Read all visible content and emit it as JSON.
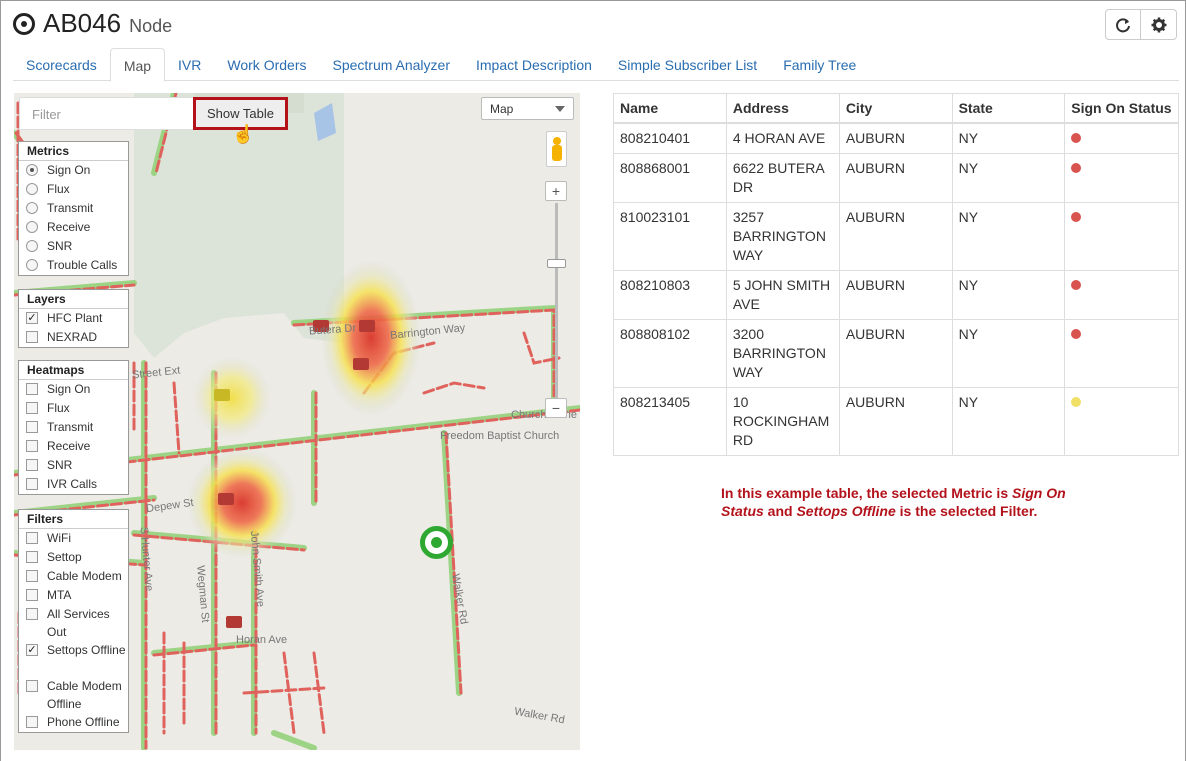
{
  "header": {
    "title": "AB046",
    "subtitle": "Node",
    "refresh_icon": "refresh-icon",
    "settings_icon": "gear-icon"
  },
  "tabs": [
    {
      "label": "Scorecards"
    },
    {
      "label": "Map",
      "active": true
    },
    {
      "label": "IVR"
    },
    {
      "label": "Work Orders"
    },
    {
      "label": "Spectrum Analyzer"
    },
    {
      "label": "Impact Description"
    },
    {
      "label": "Simple Subscriber List"
    },
    {
      "label": "Family Tree"
    }
  ],
  "map": {
    "filter_placeholder": "Filter",
    "show_table_label": "Show Table",
    "map_type": "Map",
    "zoom_in": "+",
    "zoom_out": "−",
    "streets": {
      "baptist": "Freedom Baptist Church",
      "church": "Church of the",
      "walker_rd": "Walker Rd",
      "walker_rd_v": "Walker Rd",
      "horan": "Horan Ave",
      "depew": "Depew St",
      "street_ext": "Street Ext",
      "barrington": "Barrington Way",
      "hunter": "S Hunter Ave",
      "wegman": "Wegman St",
      "john": "John Smith Ave",
      "butera": "Butera Dr"
    },
    "panels": {
      "metrics": {
        "title": "Metrics",
        "items": [
          "Sign On",
          "Flux",
          "Transmit",
          "Receive",
          "SNR",
          "Trouble Calls"
        ],
        "selected": "Sign On"
      },
      "layers": {
        "title": "Layers",
        "items": [
          {
            "label": "HFC Plant",
            "checked": true
          },
          {
            "label": "NEXRAD",
            "checked": false
          }
        ]
      },
      "heatmaps": {
        "title": "Heatmaps",
        "items": [
          "Sign On",
          "Flux",
          "Transmit",
          "Receive",
          "SNR",
          "IVR Calls"
        ]
      },
      "filters": {
        "title": "Filters",
        "items": [
          {
            "label": "WiFi",
            "checked": false
          },
          {
            "label": "Settop",
            "checked": false
          },
          {
            "label": "Cable Modem",
            "checked": false
          },
          {
            "label": "MTA",
            "checked": false
          },
          {
            "label": "All Services Out",
            "checked": false
          },
          {
            "label": "Settops Offline",
            "checked": true
          },
          {
            "label": "Cable Modem Offline",
            "checked": false
          },
          {
            "label": "Phone Offline",
            "checked": false
          }
        ]
      }
    }
  },
  "table": {
    "headers": [
      "Name",
      "Address",
      "City",
      "State",
      "Sign On Status"
    ],
    "rows": [
      {
        "name": "808210401",
        "address": "4 HORAN AVE",
        "city": "AUBURN",
        "state": "NY",
        "status_color": "#d9534f"
      },
      {
        "name": "808868001",
        "address": "6622 BUTERA DR",
        "city": "AUBURN",
        "state": "NY",
        "status_color": "#d9534f"
      },
      {
        "name": "810023101",
        "address": "3257 BARRINGTON WAY",
        "city": "AUBURN",
        "state": "NY",
        "status_color": "#d9534f"
      },
      {
        "name": "808210803",
        "address": "5 JOHN SMITH AVE",
        "city": "AUBURN",
        "state": "NY",
        "status_color": "#d9534f"
      },
      {
        "name": "808808102",
        "address": "3200 BARRINGTON WAY",
        "city": "AUBURN",
        "state": "NY",
        "status_color": "#d9534f"
      },
      {
        "name": "808213405",
        "address": "10 ROCKINGHAM RD",
        "city": "AUBURN",
        "state": "NY",
        "status_color": "#f0e068"
      }
    ]
  },
  "note": {
    "prefix": "In this example table, the selected Metric is ",
    "metric": "Sign On Status",
    "middle": " and ",
    "filter": "Settops Offline",
    "suffix": " is the selected Filter."
  }
}
